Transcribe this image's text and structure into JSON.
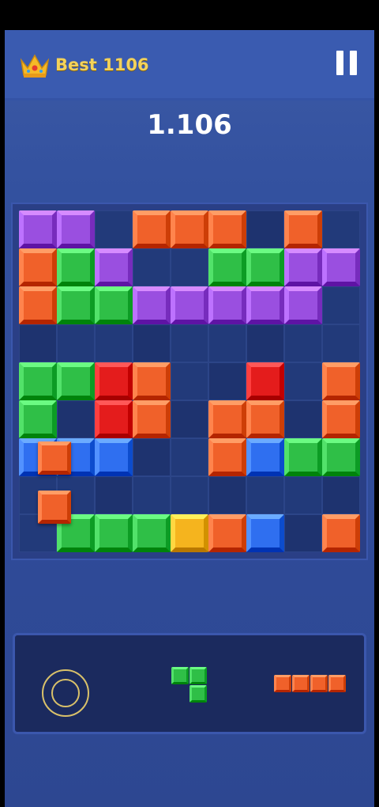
{
  "header": {
    "best_label": "Best 1106",
    "crown_icon": "crown-icon",
    "pause_icon": "pause-icon"
  },
  "score": "1.106",
  "colors": {
    "purple": "#9a4fe0",
    "orange": "#f0612a",
    "green": "#2fbf47",
    "red": "#e41c1c",
    "blue": "#2f6ff0",
    "yellow": "#f5b41e",
    "empty": "#223a7a"
  },
  "board": {
    "rows": [
      [
        "purple",
        "purple",
        "empty",
        "orange",
        "orange",
        "orange",
        "empty",
        "orange",
        "empty"
      ],
      [
        "orange",
        "green",
        "purple",
        "empty",
        "empty",
        "green",
        "green",
        "purple",
        "purple"
      ],
      [
        "orange",
        "green",
        "green",
        "purple",
        "purple",
        "purple",
        "purple",
        "purple",
        "empty"
      ],
      [
        "empty",
        "empty",
        "empty",
        "empty",
        "empty",
        "empty",
        "empty",
        "empty",
        "empty"
      ],
      [
        "green",
        "green",
        "red",
        "orange",
        "empty",
        "empty",
        "red",
        "empty",
        "orange"
      ],
      [
        "green",
        "empty",
        "red",
        "orange",
        "empty",
        "orange",
        "orange",
        "empty",
        "orange"
      ],
      [
        "blue",
        "blue",
        "blue",
        "empty",
        "empty",
        "orange",
        "blue",
        "green",
        "green"
      ],
      [
        "empty",
        "empty",
        "empty",
        "empty",
        "empty",
        "empty",
        "empty",
        "empty",
        "empty"
      ],
      [
        "empty",
        "green",
        "green",
        "green",
        "yellow",
        "orange",
        "blue",
        "empty",
        "orange"
      ]
    ],
    "floating_piece": {
      "color": "orange",
      "cells": [
        [
          6,
          0.3
        ],
        [
          7.3,
          0.3
        ]
      ]
    }
  },
  "tray": {
    "rotate_icon": "rotate-ring-icon",
    "pieces": [
      {
        "name": "green-s-piece",
        "color": "green",
        "cells": [
          [
            0,
            0
          ],
          [
            0,
            1
          ],
          [
            1,
            1
          ]
        ]
      },
      {
        "name": "orange-i-piece",
        "color": "orange",
        "cells": [
          [
            0,
            0
          ],
          [
            0,
            1
          ],
          [
            0,
            2
          ],
          [
            0,
            3
          ]
        ]
      }
    ]
  }
}
